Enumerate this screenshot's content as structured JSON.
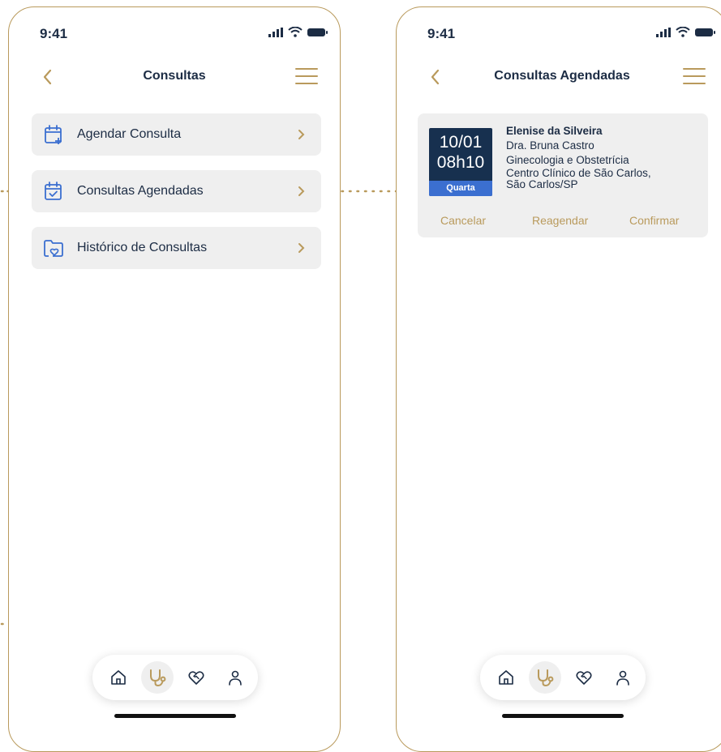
{
  "status_bar": {
    "time": "9:41"
  },
  "screen_consultas": {
    "title": "Consultas",
    "items": [
      {
        "label": "Agendar Consulta",
        "icon": "calendar-plus-icon"
      },
      {
        "label": "Consultas Agendadas",
        "icon": "calendar-check-icon"
      },
      {
        "label": "Histórico de Consultas",
        "icon": "folder-heart-icon"
      }
    ]
  },
  "screen_agendadas": {
    "title": "Consultas Agendadas",
    "appointment": {
      "date": "10/01",
      "time": "08h10",
      "weekday": "Quarta",
      "patient": "Elenise da Silveira",
      "doctor": "Dra. Bruna Castro",
      "specialty": "Ginecologia e Obstetrícia",
      "location_line1": "Centro Clínico de São Carlos,",
      "location_line2": "São Carlos/SP",
      "actions": {
        "cancel": "Cancelar",
        "reschedule": "Reagendar",
        "confirm": "Confirmar"
      }
    }
  },
  "bottom_nav": {
    "items": [
      "home-icon",
      "stethoscope-icon",
      "heart-handshake-icon",
      "user-icon"
    ],
    "active": "stethoscope-icon"
  },
  "colors": {
    "accent_gold": "#b99a5c",
    "navy": "#17304f",
    "blue": "#3b6fd0",
    "item_bg": "#efefef"
  }
}
